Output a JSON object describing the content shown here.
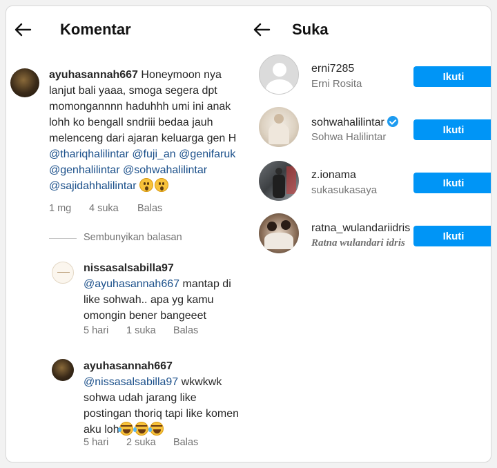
{
  "left": {
    "title": "Komentar",
    "comment": {
      "username": "ayuhasannah667",
      "text": "Honeymoon nya lanjut bali yaaa, smoga segera dpt momongannnn haduhhh umi ini anak lohh ko bengall sndriii bedaa jauh melenceng dari ajaran keluarga gen H",
      "mentions": [
        "@thariqhalilintar",
        "@fuji_an",
        "@genifaruk",
        "@genhalilintar",
        "@sohwahalilintar",
        "@sajidahhalilintar"
      ],
      "time": "1 mg",
      "likes": "4 suka",
      "reply": "Balas"
    },
    "hide_replies": "Sembunyikan balasan",
    "replies": [
      {
        "username": "nissasalsabilla97",
        "mention": "@ayuhasannah667",
        "text": "mantap di like sohwah.. apa yg kamu omongin bener bangeeet",
        "time": "5 hari",
        "likes": "1 suka",
        "reply": "Balas"
      },
      {
        "username": "ayuhasannah667",
        "mention": "@nissasalsabilla97",
        "text": "wkwkwk sohwa udah jarang like postingan thoriq tapi like komen aku loh",
        "time": "5 hari",
        "likes": "2 suka",
        "reply": "Balas"
      }
    ]
  },
  "right": {
    "title": "Suka",
    "users": [
      {
        "username": "erni7285",
        "name": "Erni Rosita",
        "button": "Ikuti",
        "verified": false
      },
      {
        "username": "sohwahalilintar",
        "name": "Sohwa Halilintar",
        "button": "Ikuti",
        "verified": true
      },
      {
        "username": "z.ionama",
        "name": "sukasukasaya",
        "button": "Ikuti",
        "verified": false
      },
      {
        "username": "ratna_wulandariidris",
        "name": "Ratna wulandari idris",
        "button": "Ikuti",
        "verified": false
      }
    ]
  },
  "colors": {
    "accent": "#0095f6",
    "mention": "#1a4f8a",
    "muted": "#737373"
  }
}
